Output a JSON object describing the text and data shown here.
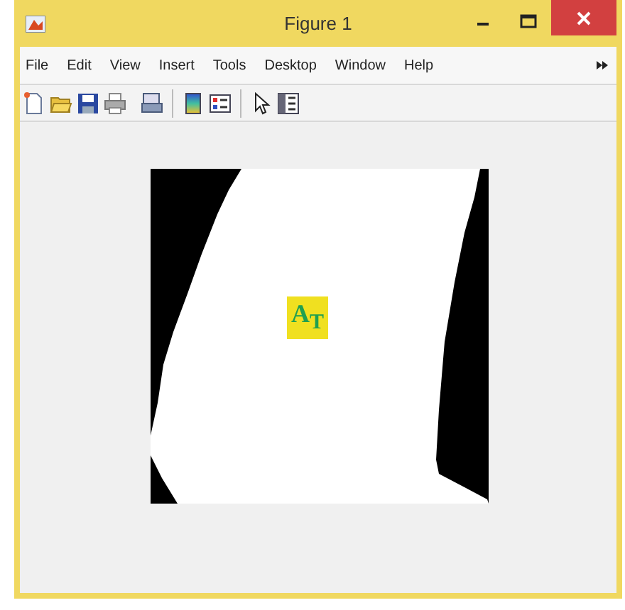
{
  "window": {
    "title": "Figure 1"
  },
  "menu": [
    {
      "label": "File"
    },
    {
      "label": "Edit"
    },
    {
      "label": "View"
    },
    {
      "label": "Insert"
    },
    {
      "label": "Tools"
    },
    {
      "label": "Desktop"
    },
    {
      "label": "Window"
    },
    {
      "label": "Help"
    }
  ],
  "figure": {
    "annotation": "A$_{T}$"
  }
}
